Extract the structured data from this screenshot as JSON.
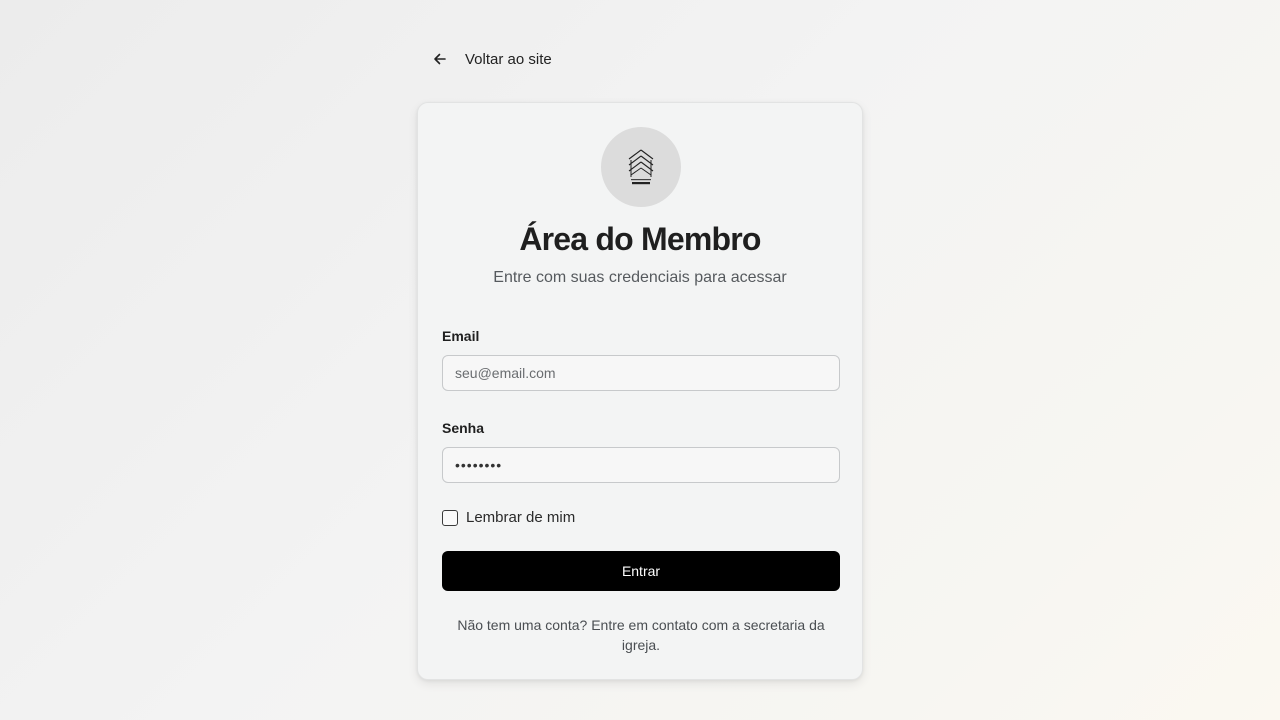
{
  "nav": {
    "back_label": "Voltar ao site",
    "back_icon": "arrow-left-icon"
  },
  "card": {
    "logo_icon": "church-logo-icon",
    "title": "Área do Membro",
    "subtitle": "Entre com suas credenciais para acessar"
  },
  "form": {
    "email_label": "Email",
    "email_placeholder": "seu@email.com",
    "email_value": "",
    "password_label": "Senha",
    "password_value": "••••••••",
    "remember_label": "Lembrar de mim",
    "remember_checked": false,
    "submit_label": "Entrar"
  },
  "footer": {
    "note": "Não tem uma conta? Entre em contato com a secretaria da igreja."
  },
  "colors": {
    "button_bg": "#000000",
    "card_bg": "#f3f4f4",
    "logo_bg": "#dcdcdc"
  }
}
